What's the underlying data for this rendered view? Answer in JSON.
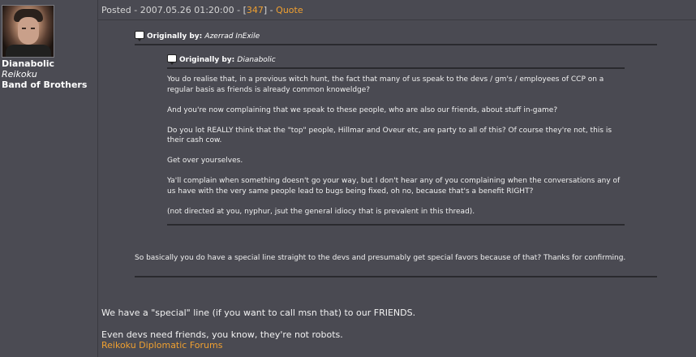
{
  "author": {
    "name": "Dianabolic",
    "corporation": "Reikoku",
    "alliance": "Band of Brothers"
  },
  "post": {
    "prefix": "Posted - ",
    "timestamp": "2007.05.26 01:20:00",
    "sep1": " - [",
    "post_number": "347",
    "sep2": "] - ",
    "quote_label": "Quote"
  },
  "outer_quote": {
    "label": "Originally by:",
    "author": "Azerrad InExile",
    "text": "So basically you do have a special line straight to the devs and presumably get special favors because of that? Thanks for confirming."
  },
  "inner_quote": {
    "label": "Originally by:",
    "author": "Dianabolic",
    "paragraphs": [
      "You do realise that, in a previous witch hunt, the fact that many of us speak to the devs / gm's / employees of CCP on a regular basis as friends is already common knoweldge?",
      "And you're now complaining that we speak to these people, who are also our friends, about stuff in-game?",
      "Do you lot REALLY think that the \"top\" people, Hillmar and Oveur etc, are party to all of this? Of course they're not, this is their cash cow.",
      "Get over yourselves.",
      "Ya'll complain when something doesn't go your way, but I don't hear any of you complaining when the conversations any of us have with the very same people lead to bugs being fixed, oh no, because that's a benefit RIGHT?",
      "(not directed at you, nyphur, jsut the general idiocy that is prevalent in this thread)."
    ]
  },
  "reply": {
    "line1": "We have a \"special\" line (if you want to call msn that) to our FRIENDS.",
    "line2": "Even devs need friends, you know, they're not robots."
  },
  "signature": {
    "link_text": "Reikoku Diplomatic Forums"
  },
  "colors": {
    "background": "#4a4a52",
    "link": "#f0a030",
    "text": "#f0f0f0"
  }
}
